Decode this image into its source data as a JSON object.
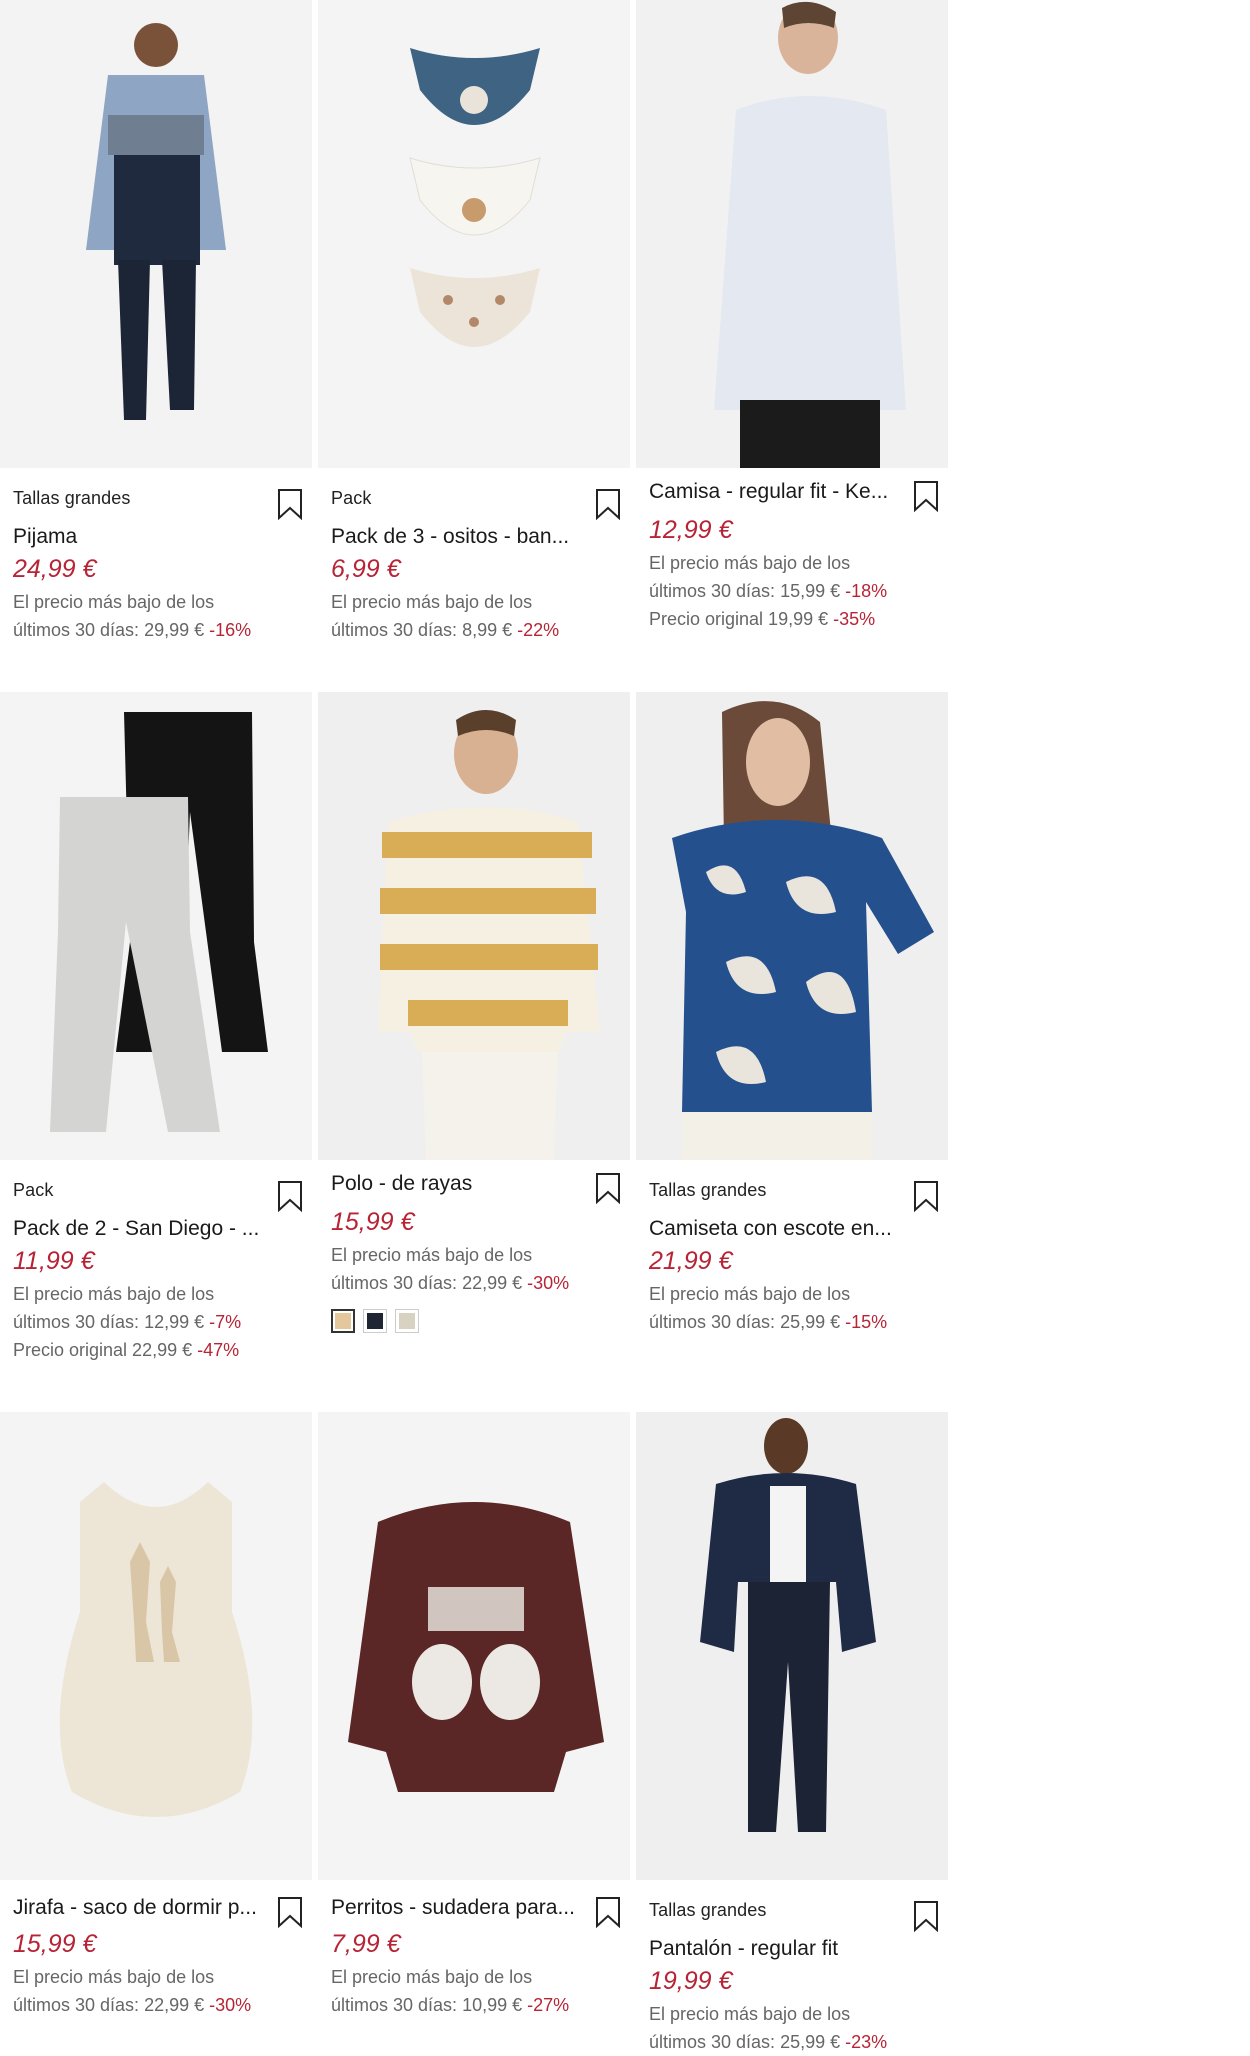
{
  "products": [
    {
      "tag": "Tallas grandes",
      "title": "Pijama",
      "price": "24,99 €",
      "notes": [
        {
          "text": "El precio más bajo de los",
          "pct": ""
        },
        {
          "text": "últimos 30 días: 29,99 € ",
          "pct": "-16%"
        }
      ]
    },
    {
      "tag": "Pack",
      "title": "Pack de 3 - ositos - ban...",
      "price": "6,99 €",
      "notes": [
        {
          "text": "El precio más bajo de los",
          "pct": ""
        },
        {
          "text": "últimos 30 días: 8,99 € ",
          "pct": "-22%"
        }
      ]
    },
    {
      "tag": "",
      "title": "Camisa - regular fit - Ke...",
      "price": "12,99 €",
      "notes": [
        {
          "text": "El precio más bajo de los",
          "pct": ""
        },
        {
          "text": "últimos 30 días: 15,99 € ",
          "pct": "-18%"
        },
        {
          "text": "Precio original 19,99 € ",
          "pct": "-35%"
        }
      ]
    },
    {
      "tag": "Pack",
      "title": "Pack de 2 - San Diego - ...",
      "price": "11,99 €",
      "notes": [
        {
          "text": "El precio más bajo de los",
          "pct": ""
        },
        {
          "text": "últimos 30 días: 12,99 € ",
          "pct": "-7%"
        },
        {
          "text": "Precio original 22,99 € ",
          "pct": "-47%"
        }
      ]
    },
    {
      "tag": "",
      "title": "Polo - de rayas",
      "price": "15,99 €",
      "notes": [
        {
          "text": "El precio más bajo de los",
          "pct": ""
        },
        {
          "text": "últimos 30 días: 22,99 € ",
          "pct": "-30%"
        }
      ],
      "swatches": [
        {
          "color": "#e4c79a",
          "selected": true
        },
        {
          "color": "#1f2533",
          "selected": false
        },
        {
          "color": "#d8d2c2",
          "selected": false
        }
      ]
    },
    {
      "tag": "Tallas grandes",
      "title": "Camiseta con escote en...",
      "price": "21,99 €",
      "notes": [
        {
          "text": "El precio más bajo de los",
          "pct": ""
        },
        {
          "text": "últimos 30 días: 25,99 € ",
          "pct": "-15%"
        }
      ]
    },
    {
      "tag": "",
      "title": "Jirafa - saco de dormir p...",
      "price": "15,99 €",
      "notes": [
        {
          "text": "El precio más bajo de los",
          "pct": ""
        },
        {
          "text": "últimos 30 días: 22,99 € ",
          "pct": "-30%"
        }
      ]
    },
    {
      "tag": "",
      "title": "Perritos - sudadera para...",
      "price": "7,99 €",
      "notes": [
        {
          "text": "El precio más bajo de los",
          "pct": ""
        },
        {
          "text": "últimos 30 días: 10,99 € ",
          "pct": "-27%"
        }
      ]
    },
    {
      "tag": "Tallas grandes",
      "title": "Pantalón - regular fit",
      "price": "19,99 €",
      "notes": [
        {
          "text": "El precio más bajo de los",
          "pct": ""
        },
        {
          "text": "últimos 30 días: 25,99 € ",
          "pct": "-23%"
        }
      ]
    }
  ],
  "icons": {
    "bookmark": "bookmark-icon"
  },
  "colors": {
    "sale_price": "#b72436",
    "note_text": "#666666"
  }
}
